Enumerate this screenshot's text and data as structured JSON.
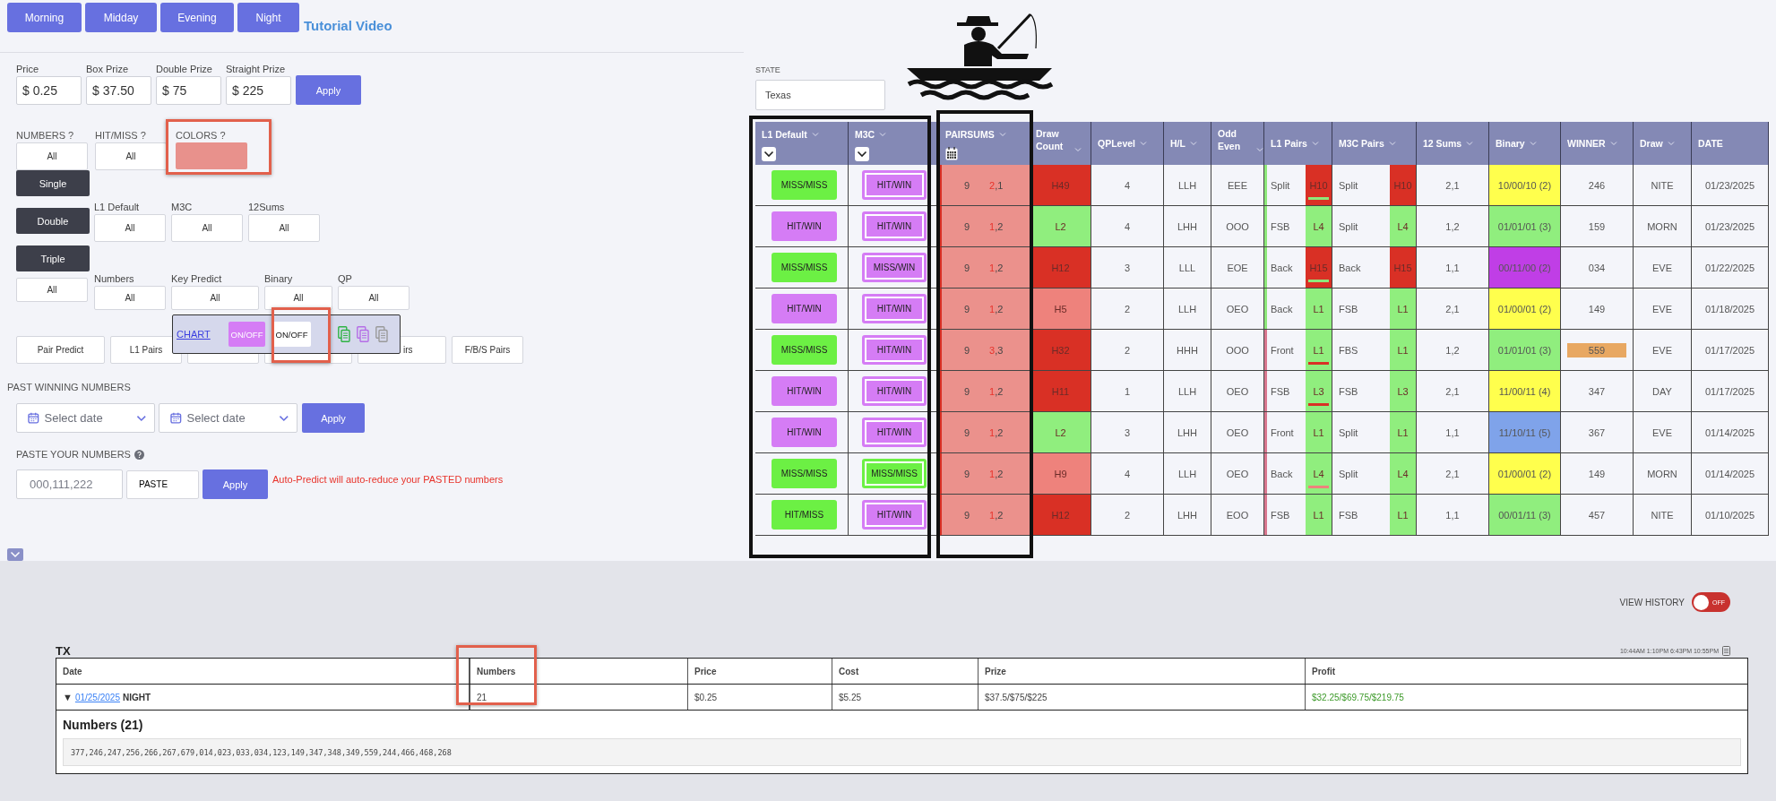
{
  "tabs": [
    {
      "label": "Morning"
    },
    {
      "label": "Midday"
    },
    {
      "label": "Evening"
    },
    {
      "label": "Night"
    }
  ],
  "tutorial_link": "Tutorial Video",
  "prices": [
    {
      "label": "Price",
      "value": "$ 0.25"
    },
    {
      "label": "Box Prize",
      "value": "$ 37.50"
    },
    {
      "label": "Double Prize",
      "value": "$ 75"
    },
    {
      "label": "Straight Prize",
      "value": "$ 225"
    }
  ],
  "price_apply": "Apply",
  "filters_top": [
    {
      "label": "NUMBERS ?",
      "value": "All"
    },
    {
      "label": "HIT/MISS ?",
      "value": "All"
    }
  ],
  "colors": {
    "label": "COLORS ?",
    "color": "#e8918c"
  },
  "type_buttons": [
    {
      "label": "Single"
    },
    {
      "label": "Double"
    },
    {
      "label": "Triple"
    }
  ],
  "type_all": "All",
  "filters_mid": [
    {
      "label": "L1 Default",
      "value": "All"
    },
    {
      "label": "M3C",
      "value": "All"
    },
    {
      "label": "12Sums",
      "value": "All"
    }
  ],
  "filters_low": [
    {
      "label": "Numbers",
      "value": "All"
    },
    {
      "label": "Key Predict",
      "value": "All"
    },
    {
      "label": "Binary",
      "value": "All"
    },
    {
      "label": "QP",
      "value": "All"
    }
  ],
  "pair_buttons": [
    {
      "kind": "full",
      "label": "Pair Predict"
    },
    {
      "kind": "full",
      "label": "L1 Pairs"
    },
    {
      "kind": "hidden"
    },
    {
      "kind": "hidden"
    },
    {
      "kind": "clipped",
      "label": "irs"
    },
    {
      "kind": "full",
      "label": "F/B/S Pairs"
    }
  ],
  "chart_popup": {
    "link": "CHART",
    "toggles": [
      {
        "label": "ON/OFF",
        "on": true
      },
      {
        "label": "ON/OFF",
        "on": false
      }
    ],
    "icons": [
      {
        "color": "#2fb344"
      },
      {
        "color": "#b56ee6"
      },
      {
        "color": "#9a9a9a"
      }
    ]
  },
  "past": {
    "label": "PAST WINNING NUMBERS",
    "pickers": [
      {
        "placeholder": "Select date"
      },
      {
        "placeholder": "Select date"
      }
    ],
    "apply": "Apply"
  },
  "paste": {
    "label": "PASTE YOUR NUMBERS",
    "placeholder": "000,111,222",
    "button": "PASTE",
    "apply": "Apply",
    "note": "Auto-Predict will auto-reduce your PASTED numbers"
  },
  "state": {
    "label": "STATE",
    "value": "Texas"
  },
  "table": {
    "columns": [
      {
        "label": "L1 Default",
        "sortable": true,
        "kind": "dropdown"
      },
      {
        "label": "M3C",
        "sortable": true,
        "kind": "dropdown"
      },
      {
        "label": "PAIRSUMS",
        "sortable": true,
        "kind": "calendar"
      },
      {
        "label": "Draw Count",
        "sortable": true,
        "kind": "plain"
      },
      {
        "label": "QPLevel",
        "sortable": true,
        "kind": "plain"
      },
      {
        "label": "H/L",
        "sortable": true,
        "kind": "plain"
      },
      {
        "label": "Odd Even",
        "sortable": true,
        "kind": "plain"
      },
      {
        "label": "L1 Pairs",
        "sortable": true,
        "kind": "plain"
      },
      {
        "label": "M3C Pairs",
        "sortable": true,
        "kind": "plain"
      },
      {
        "label": "12 Sums",
        "sortable": true,
        "kind": "plain"
      },
      {
        "label": "Binary",
        "sortable": true,
        "kind": "plain"
      },
      {
        "label": "WINNER",
        "sortable": true,
        "kind": "plain"
      },
      {
        "label": "Draw",
        "sortable": true,
        "kind": "plain"
      },
      {
        "label": "DATE",
        "sortable": false,
        "kind": "plain"
      }
    ],
    "rows": [
      {
        "l1_default": {
          "text": "MISS/MISS",
          "color": "#6cf044"
        },
        "m3c": {
          "text": "HIT/WIN",
          "color": "#d57cf5"
        },
        "pairsum": "9",
        "pair": "2,1",
        "draw_count": {
          "text": "H49",
          "color": "#d93025"
        },
        "qp_level": "4",
        "hl": "LLH",
        "odd_even": "EEE",
        "l1_pair": {
          "text": "Split",
          "level": "H10",
          "color": "#d93025",
          "stripe": {
            "color": "#8ee87a"
          },
          "underline": {
            "color": "#8ee87a"
          }
        },
        "m3c_pair": {
          "text": "Split",
          "level": "H10",
          "color": "#d93025"
        },
        "sums12": "2,1",
        "binary": {
          "text": "10/00/10 (2)",
          "color": "#ffff4d"
        },
        "winner": {
          "text": "246",
          "highlighted": false
        },
        "draw": "NITE",
        "date": "01/23/2025"
      },
      {
        "l1_default": {
          "text": "HIT/WIN",
          "color": "#d57cf5"
        },
        "m3c": {
          "text": "HIT/WIN",
          "color": "#d57cf5"
        },
        "pairsum": "9",
        "pair": "1,2",
        "draw_count": {
          "text": "L2",
          "color": "#90ee7e"
        },
        "qp_level": "4",
        "hl": "LHH",
        "odd_even": "OOO",
        "l1_pair": {
          "text": "FSB",
          "level": "L4",
          "color": "#90ee7e",
          "stripe": {
            "color": "#8ee87a"
          }
        },
        "m3c_pair": {
          "text": "Split",
          "level": "L4",
          "color": "#90ee7e"
        },
        "sums12": "1,2",
        "binary": {
          "text": "01/01/01 (3)",
          "color": "#90ee7e"
        },
        "winner": {
          "text": "159",
          "highlighted": false
        },
        "draw": "MORN",
        "date": "01/23/2025"
      },
      {
        "l1_default": {
          "text": "MISS/MISS",
          "color": "#6cf044"
        },
        "m3c": {
          "text": "MISS/WIN",
          "color": "#d57cf5"
        },
        "pairsum": "9",
        "pair": "1,2",
        "draw_count": {
          "text": "H12",
          "color": "#d93025"
        },
        "qp_level": "3",
        "hl": "LLL",
        "odd_even": "EOE",
        "l1_pair": {
          "text": "Back",
          "level": "H15",
          "color": "#d93025",
          "stripe": {
            "color": "#8ee87a"
          },
          "underline": {
            "color": "#8ee87a"
          }
        },
        "m3c_pair": {
          "text": "Back",
          "level": "H15",
          "color": "#d93025"
        },
        "sums12": "1,1",
        "binary": {
          "text": "00/11/00 (2)",
          "color": "#c03ee6"
        },
        "winner": {
          "text": "034",
          "highlighted": false
        },
        "draw": "EVE",
        "date": "01/22/2025"
      },
      {
        "l1_default": {
          "text": "HIT/WIN",
          "color": "#d57cf5"
        },
        "m3c": {
          "text": "HIT/WIN",
          "color": "#d57cf5"
        },
        "pairsum": "9",
        "pair": "1,2",
        "draw_count": {
          "text": "H5",
          "color": "#ee827c"
        },
        "qp_level": "2",
        "hl": "LLH",
        "odd_even": "OEO",
        "l1_pair": {
          "text": "Back",
          "level": "L1",
          "color": "#90ee7e",
          "stripe": {
            "color": "#8ee87a"
          }
        },
        "m3c_pair": {
          "text": "FSB",
          "level": "L1",
          "color": "#90ee7e"
        },
        "sums12": "2,1",
        "binary": {
          "text": "01/00/01 (2)",
          "color": "#ffff4d"
        },
        "winner": {
          "text": "149",
          "highlighted": false
        },
        "draw": "EVE",
        "date": "01/18/2025"
      },
      {
        "l1_default": {
          "text": "MISS/MISS",
          "color": "#6cf044"
        },
        "m3c": {
          "text": "HIT/WIN",
          "color": "#d57cf5"
        },
        "pairsum": "9",
        "pair": "3,3",
        "draw_count": {
          "text": "H32",
          "color": "#d93025"
        },
        "qp_level": "2",
        "hl": "HHH",
        "odd_even": "OOO",
        "l1_pair": {
          "text": "Front",
          "level": "L1",
          "color": "#90ee7e",
          "stripe": {
            "color": "#d9788f"
          },
          "underline": {
            "color": "#d93025"
          }
        },
        "m3c_pair": {
          "text": "FBS",
          "level": "L1",
          "color": "#90ee7e"
        },
        "sums12": "1,2",
        "binary": {
          "text": "01/01/01 (3)",
          "color": "#90ee7e"
        },
        "winner": {
          "text": "559",
          "highlighted": true
        },
        "draw": "EVE",
        "date": "01/17/2025"
      },
      {
        "l1_default": {
          "text": "HIT/WIN",
          "color": "#d57cf5"
        },
        "m3c": {
          "text": "HIT/WIN",
          "color": "#d57cf5"
        },
        "pairsum": "9",
        "pair": "1,2",
        "draw_count": {
          "text": "H11",
          "color": "#d93025"
        },
        "qp_level": "1",
        "hl": "LLH",
        "odd_even": "OEO",
        "l1_pair": {
          "text": "FSB",
          "level": "L3",
          "color": "#90ee7e",
          "stripe": {
            "color": "#d9788f"
          },
          "underline": {
            "color": "#d93025"
          }
        },
        "m3c_pair": {
          "text": "FSB",
          "level": "L3",
          "color": "#90ee7e"
        },
        "sums12": "2,1",
        "binary": {
          "text": "11/00/11 (4)",
          "color": "#ffff4d"
        },
        "winner": {
          "text": "347",
          "highlighted": false
        },
        "draw": "DAY",
        "date": "01/17/2025"
      },
      {
        "l1_default": {
          "text": "HIT/WIN",
          "color": "#d57cf5"
        },
        "m3c": {
          "text": "HIT/WIN",
          "color": "#d57cf5"
        },
        "pairsum": "9",
        "pair": "1,2",
        "draw_count": {
          "text": "L2",
          "color": "#90ee7e"
        },
        "qp_level": "3",
        "hl": "LHH",
        "odd_even": "OEO",
        "l1_pair": {
          "text": "Front",
          "level": "L1",
          "color": "#90ee7e",
          "stripe": {
            "color": "#d9788f"
          }
        },
        "m3c_pair": {
          "text": "Split",
          "level": "L1",
          "color": "#90ee7e"
        },
        "sums12": "1,1",
        "binary": {
          "text": "11/10/11 (5)",
          "color": "#7fa3ea"
        },
        "winner": {
          "text": "367",
          "highlighted": false
        },
        "draw": "EVE",
        "date": "01/14/2025"
      },
      {
        "l1_default": {
          "text": "MISS/MISS",
          "color": "#6cf044"
        },
        "m3c": {
          "text": "MISS/MISS",
          "color": "#6cf044"
        },
        "pairsum": "9",
        "pair": "1,2",
        "draw_count": {
          "text": "H9",
          "color": "#ee827c"
        },
        "qp_level": "4",
        "hl": "LLH",
        "odd_even": "OEO",
        "l1_pair": {
          "text": "Back",
          "level": "L4",
          "color": "#90ee7e",
          "stripe": {
            "color": "#d9788f"
          },
          "underline": {
            "color": "#ee827c"
          }
        },
        "m3c_pair": {
          "text": "Split",
          "level": "L4",
          "color": "#90ee7e"
        },
        "sums12": "2,1",
        "binary": {
          "text": "01/00/01 (2)",
          "color": "#ffff4d"
        },
        "winner": {
          "text": "149",
          "highlighted": false
        },
        "draw": "MORN",
        "date": "01/14/2025"
      },
      {
        "l1_default": {
          "text": "HIT/MISS",
          "color": "#6cf044"
        },
        "m3c": {
          "text": "HIT/WIN",
          "color": "#d57cf5"
        },
        "pairsum": "9",
        "pair": "1,2",
        "draw_count": {
          "text": "H12",
          "color": "#d93025"
        },
        "qp_level": "2",
        "hl": "LHH",
        "odd_even": "EOO",
        "l1_pair": {
          "text": "FSB",
          "level": "L1",
          "color": "#90ee7e",
          "stripe": {
            "color": "#d9788f"
          }
        },
        "m3c_pair": {
          "text": "FSB",
          "level": "L1",
          "color": "#90ee7e"
        },
        "sums12": "1,1",
        "binary": {
          "text": "00/01/11 (3)",
          "color": "#90ee7e"
        },
        "winner": {
          "text": "457",
          "highlighted": false
        },
        "draw": "NITE",
        "date": "01/10/2025"
      }
    ]
  },
  "history": {
    "label": "VIEW HISTORY",
    "on": false,
    "toggle_text": "OFF"
  },
  "results": {
    "title": "TX",
    "times": "10:44AM 1:10PM 6:43PM 10:55PM",
    "columns": [
      "Date",
      "Numbers",
      "Price",
      "Cost",
      "Prize",
      "Profit"
    ],
    "row": {
      "toggle": "▼",
      "date_link": "01/25/2025",
      "draw": "NIGHT",
      "numbers": "21",
      "price": "$0.25",
      "cost": "$5.25",
      "prize": "$37.5/$75/$225",
      "profit": "$32.25/$69.75/$219.75"
    },
    "expanded": true,
    "detail_title": "Numbers (21)",
    "detail_numbers": "377,246,247,256,266,267,679,014,023,033,034,123,149,347,348,349,559,244,466,468,268"
  }
}
